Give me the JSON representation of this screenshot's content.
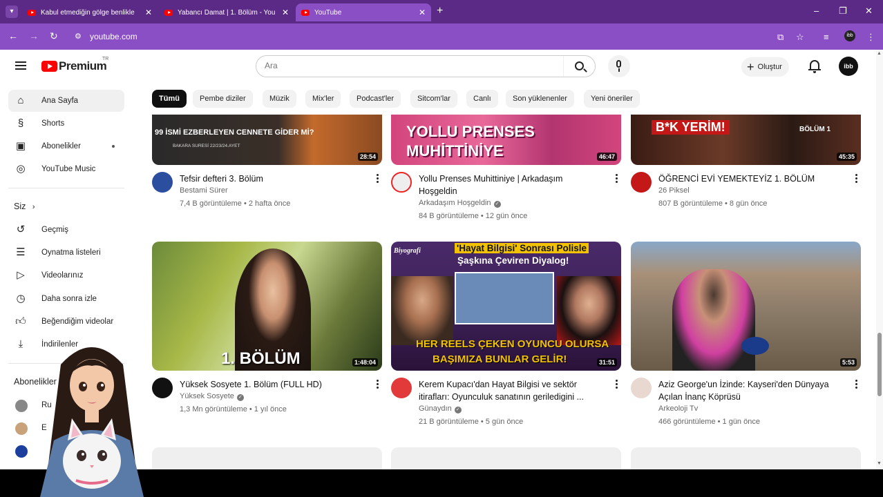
{
  "browser": {
    "tabs": [
      {
        "label": "Kabul etmediğin gölge benlikle"
      },
      {
        "label": "Yabancı Damat | 1. Bölüm - You"
      },
      {
        "label": "YouTube"
      }
    ],
    "url": "youtube.com"
  },
  "header": {
    "logo_text": "Premium",
    "logo_region": "TR",
    "search_placeholder": "Ara",
    "create_label": "Oluştur",
    "avatar_text": "ibb"
  },
  "sidebar": {
    "main": [
      {
        "label": "Ana Sayfa",
        "icon": "home-icon"
      },
      {
        "label": "Shorts",
        "icon": "shorts-icon"
      },
      {
        "label": "Abonelikler",
        "icon": "subscriptions-icon"
      },
      {
        "label": "YouTube Music",
        "icon": "youtube-music-icon"
      }
    ],
    "you_heading": "Siz",
    "you": [
      {
        "label": "Geçmiş",
        "icon": "history-icon"
      },
      {
        "label": "Oynatma listeleri",
        "icon": "playlists-icon"
      },
      {
        "label": "Videolarınız",
        "icon": "your-videos-icon"
      },
      {
        "label": "Daha sonra izle",
        "icon": "watch-later-icon"
      },
      {
        "label": "Beğendiğim videolar",
        "icon": "liked-videos-icon"
      },
      {
        "label": "İndirilenler",
        "icon": "downloads-icon"
      }
    ],
    "subs_heading": "Abonelikler",
    "subs": [
      {
        "label": "Ru"
      },
      {
        "label": "E"
      },
      {
        "label": ""
      }
    ]
  },
  "chips": [
    "Tümü",
    "Pembe diziler",
    "Müzik",
    "Mix'ler",
    "Podcast'ler",
    "Sitcom'lar",
    "Canlı",
    "Son yüklenenler",
    "Yeni öneriler"
  ],
  "videos_row1": [
    {
      "title": "Tefsir defteri 3. Bölüm",
      "channel": "Bestami Sürer",
      "stats": "7,4 B görüntüleme • 2 hafta önce",
      "duration": "28:54",
      "thumb_text1": "99 İSMİ EZBERLEYEN CENNETE GİDER Mİ?",
      "thumb_text2": "BAKARA SURESİ 22/23/24.AYET",
      "verified": false
    },
    {
      "title": "Yollu Prenses Muhittiniye | Arkadaşım Hoşgeldin",
      "channel": "Arkadaşım Hoşgeldin",
      "stats": "84 B görüntüleme • 12 gün önce",
      "duration": "46:47",
      "thumb_text1": "YOLLU PRENSES",
      "thumb_text2": "MUHİTTİNİYE",
      "verified": true
    },
    {
      "title": "ÖĞRENCİ EVİ YEMEKTEYİZ 1. BÖLÜM",
      "channel": "26 Piksel",
      "stats": "807 B görüntüleme • 8 gün önce",
      "duration": "45:35",
      "thumb_text1": "B*K YERİM!",
      "thumb_text2": "BÖLÜM 1",
      "verified": false
    }
  ],
  "videos_row2": [
    {
      "title": "Yüksek Sosyete 1. Bölüm (FULL HD)",
      "channel": "Yüksek Sosyete",
      "stats": "1,3 Mn görüntüleme • 1 yıl önce",
      "duration": "1:48:04",
      "thumb_text1": "1. BÖLÜM",
      "thumb_text2": "",
      "verified": true
    },
    {
      "title": "Kerem Kupacı'dan Hayat Bilgisi ve sektör itirafları: Oyunculuk sanatının geriledigini ...",
      "channel": "Günaydın",
      "stats": "21 B görüntüleme • 5 gün önce",
      "duration": "31:51",
      "thumb_text1": "'Hayat Bilgisi' Sonrası Polisle",
      "thumb_text2": "Şaşkına Çeviren Diyalog!",
      "thumb_text3": "HER REELS ÇEKEN OYUNCU OLURSA",
      "thumb_text4": "BAŞIMIZA BUNLAR GELİR!",
      "thumb_text5": "Biyografi",
      "verified": true
    },
    {
      "title": "Aziz George'un İzinde: Kayseri'den Dünyaya Açılan İnanç Köprüsü",
      "channel": "Arkeoloji Tv",
      "stats": "466 görüntüleme • 1 gün önce",
      "duration": "5:53",
      "verified": false
    }
  ],
  "colors": {
    "tabbar": "#5b2a86",
    "addressbar": "#8a4fc4",
    "yt_red": "#ff0000"
  }
}
